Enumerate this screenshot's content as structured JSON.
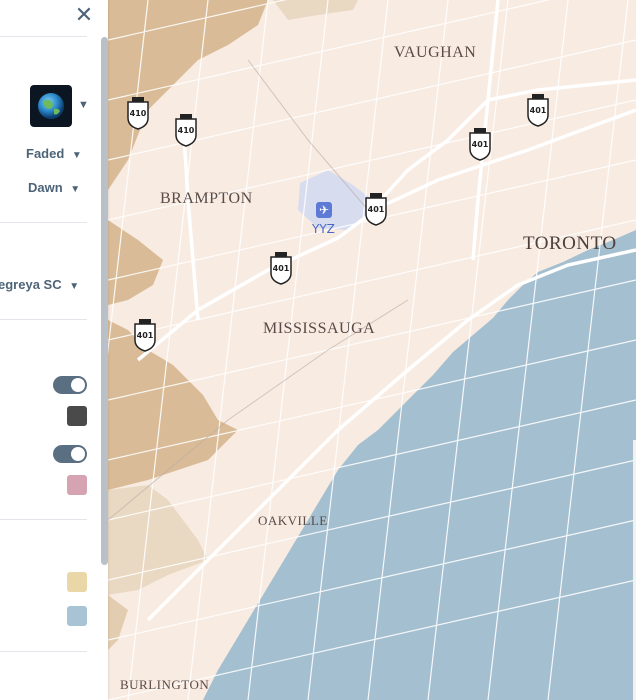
{
  "panel": {
    "basemap_icon": "globe-icon",
    "style_option": "Faded",
    "time_option": "Dawn",
    "font_option": "egreya SC",
    "toggle1_on": true,
    "toggle2_on": true,
    "swatch1_color": "#4a4a4a",
    "swatch2_color": "#d6a3b3",
    "swatch3_color": "#ead7a8",
    "swatch4_color": "#a8c4d4"
  },
  "map": {
    "places": {
      "vaughan": "VAUGHAN",
      "brampton": "BRAMPTON",
      "toronto": "TORONTO",
      "mississauga": "MISSISSAUGA",
      "oakville": "OAKVILLE",
      "burlington": "BURLINGTON"
    },
    "airport": "YYZ",
    "highways": [
      "410",
      "410",
      "401",
      "401",
      "401",
      "401",
      "401"
    ],
    "colors": {
      "water": "#a3bfd0",
      "land": "#f8ebe2",
      "farmland": "#d9bc97",
      "road": "#ffffff",
      "airport": "#d8dcef"
    }
  }
}
